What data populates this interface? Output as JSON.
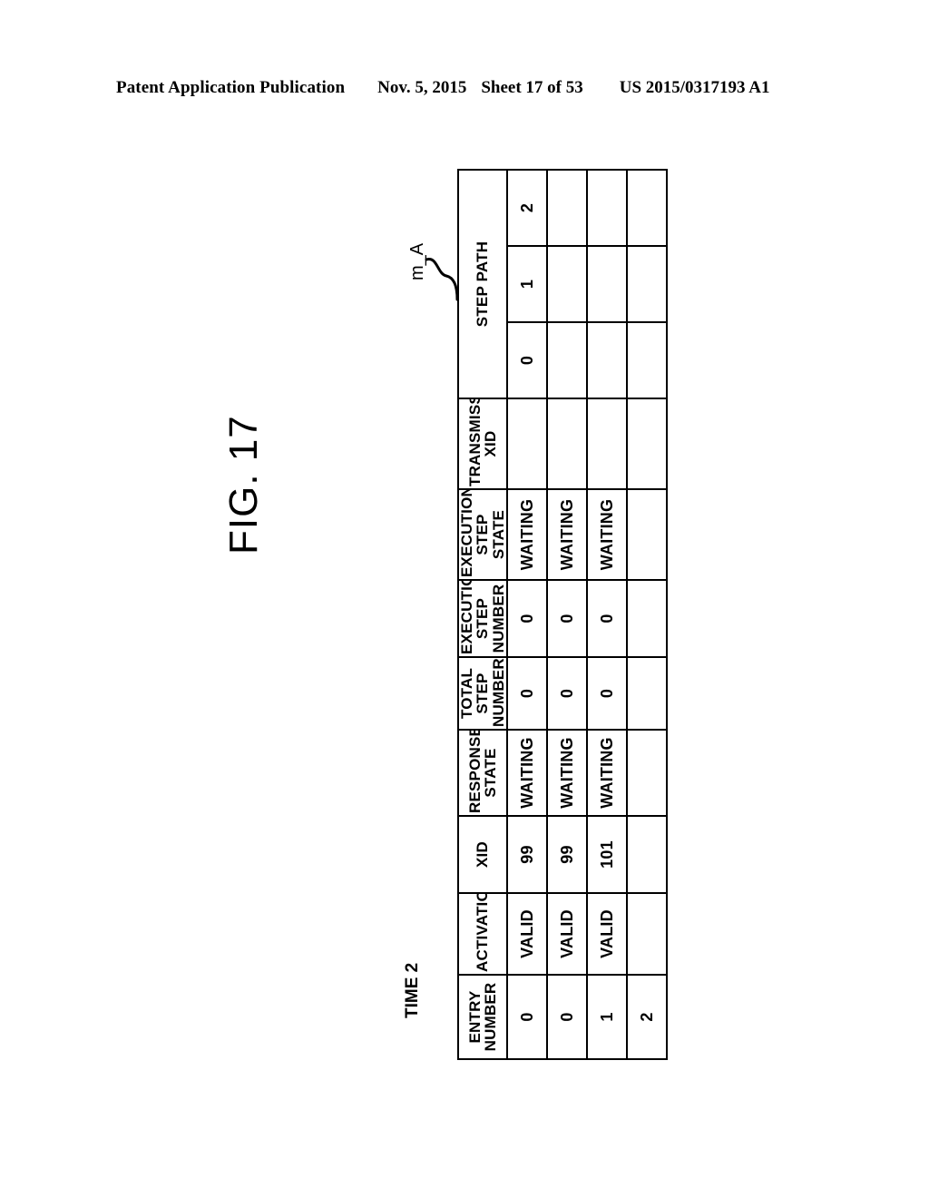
{
  "page_header": {
    "publication": "Patent Application Publication",
    "date": "Nov. 5, 2015",
    "sheet": "Sheet 17 of 53",
    "number": "US 2015/0317193 A1"
  },
  "figure": {
    "title": "FIG. 17",
    "time_label": "TIME 2",
    "reference_label": "m_A"
  },
  "table": {
    "columns": [
      {
        "key": "entry_number",
        "label": "ENTRY\nNUMBER"
      },
      {
        "key": "activation",
        "label": "ACTIVATION"
      },
      {
        "key": "xid",
        "label": "XID"
      },
      {
        "key": "response_state",
        "label": "RESPONSE\nSTATE"
      },
      {
        "key": "total_step_number",
        "label": "TOTAL\nSTEP\nNUMBER"
      },
      {
        "key": "execution_step_number",
        "label": "EXECUTION\nSTEP\nNUMBER"
      },
      {
        "key": "execution_step_state",
        "label": "EXECUTION\nSTEP STATE"
      },
      {
        "key": "transmission_xid",
        "label": "TRANSMISSION\nXID"
      },
      {
        "key": "step_path",
        "label": "STEP PATH"
      }
    ],
    "headers": {
      "entry_number_l1": "ENTRY",
      "entry_number_l2": "NUMBER",
      "activation": "ACTIVATION",
      "xid": "XID",
      "response_state_l1": "RESPONSE",
      "response_state_l2": "STATE",
      "total_step_number_l1": "TOTAL",
      "total_step_number_l2": "STEP",
      "total_step_number_l3": "NUMBER",
      "execution_step_number_l1": "EXECUTION",
      "execution_step_number_l2": "STEP",
      "execution_step_number_l3": "NUMBER",
      "execution_step_state_l1": "EXECUTION",
      "execution_step_state_l2": "STEP STATE",
      "transmission_xid_l1": "TRANSMISSION",
      "transmission_xid_l2": "XID",
      "step_path": "STEP PATH"
    },
    "step_path_subcolumns": [
      "0",
      "1",
      "2"
    ],
    "rows": [
      {
        "entry_number": "0",
        "activation": "VALID",
        "xid": "99",
        "response_state": "WAITING",
        "total_step_number": "0",
        "execution_step_number": "0",
        "execution_step_state": "WAITING",
        "transmission_xid": "",
        "step_path": [
          "",
          "",
          ""
        ]
      },
      {
        "entry_number": "1",
        "activation": "VALID",
        "xid": "101",
        "response_state": "WAITING",
        "total_step_number": "0",
        "execution_step_number": "0",
        "execution_step_state": "WAITING",
        "transmission_xid": "",
        "step_path": [
          "",
          "",
          ""
        ]
      },
      {
        "entry_number": "2",
        "activation": "",
        "xid": "",
        "response_state": "",
        "total_step_number": "",
        "execution_step_number": "",
        "execution_step_state": "",
        "transmission_xid": "",
        "step_path": [
          "",
          "",
          ""
        ]
      }
    ]
  },
  "colors": {
    "ink": "#000000",
    "paper": "#ffffff"
  }
}
